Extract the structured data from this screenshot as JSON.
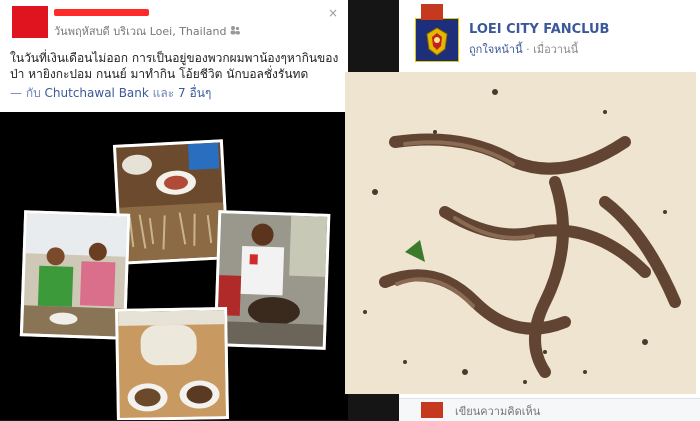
{
  "left_post": {
    "timestamp": "วันพฤหัสบดี",
    "location": "บริเวณ Loei, Thailand",
    "close_label": "×",
    "text": "ในวันที่เงินเดือนไม่ออก การเป็นอยู่ของพวกผมพาน้องๆหากินของป่า หายิงกะปอม กนนย์ มาทำกิน โอ้ยชีวิต นักบอลชั่งรันทด",
    "tag_prefix": "— กับ",
    "tag_name": "Chutchawal Bank",
    "tag_and": "และ",
    "tag_others": "7 อื่นๆ"
  },
  "right_post": {
    "page_name": "LOEI CITY FANCLUB",
    "page_sub_link": "ถูกใจหน้านี้",
    "page_sub_time": "· เมื่อวานนี้",
    "logo_text": "LOEI CITY FANCLUB",
    "comment_placeholder": "เขียนความคิดเห็น"
  },
  "colors": {
    "link": "#3b5998",
    "redaction": "#ff2a2a"
  }
}
